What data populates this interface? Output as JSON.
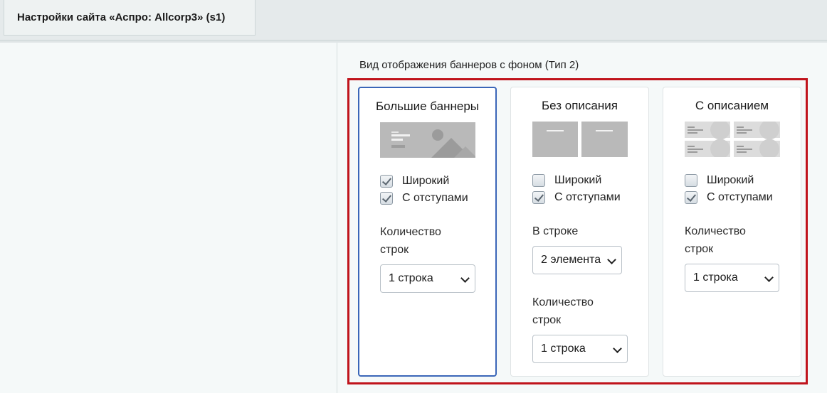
{
  "tab": {
    "title": "Настройки сайта «Аспро: Allcorp3» (s1)"
  },
  "section": {
    "label": "Вид отображения баннеров с фоном (Тип 2)"
  },
  "cards": [
    {
      "title": "Большие баннеры",
      "selected": true,
      "wide_label": "Широкий",
      "wide_checked": true,
      "padding_label": "С отступами",
      "padding_checked": true,
      "rows_label_1": "Количество",
      "rows_label_2": "строк",
      "rows_value": "1 строка"
    },
    {
      "title": "Без описания",
      "selected": false,
      "wide_label": "Широкий",
      "wide_checked": false,
      "padding_label": "С отступами",
      "padding_checked": true,
      "per_row_label": "В строке",
      "per_row_value": "2 элемента",
      "rows_label_1": "Количество",
      "rows_label_2": "строк",
      "rows_value": "1 строка"
    },
    {
      "title": "С описанием",
      "selected": false,
      "wide_label": "Широкий",
      "wide_checked": false,
      "padding_label": "С отступами",
      "padding_checked": true,
      "rows_label_1": "Количество",
      "rows_label_2": "строк",
      "rows_value": "1 строка"
    }
  ],
  "icons": {
    "large_banner": "large-banner-preview-icon",
    "no_description": "two-banners-preview-icon",
    "with_description": "four-banners-preview-icon",
    "select_arrow": "chevron-down-icon",
    "checkbox": "checkmark-icon"
  },
  "colors": {
    "highlight_border": "#c0141c",
    "selected_card_border": "#3a66b8",
    "preview_gray": "#b9b9b9"
  }
}
